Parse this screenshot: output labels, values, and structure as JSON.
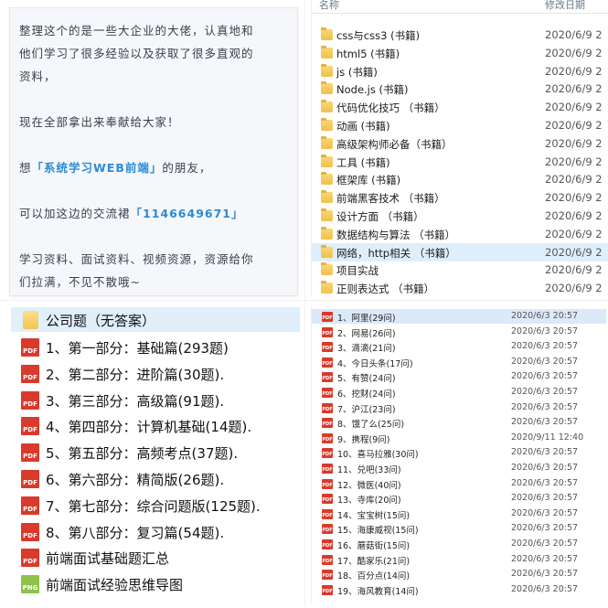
{
  "note": {
    "line1": "整理这个的是一些大企业的大佬，认真地和",
    "line2": "他们学习了很多经验以及获取了很多直观的",
    "line3": "资料，",
    "line4": "现在全部拿出来奉献给大家！",
    "line5_pre": "想",
    "line5_hl": "「系统学习WEB前端」",
    "line5_post": "的朋友，",
    "line6_pre": "可以加这边的交流裙",
    "line6_hl": "「1146649671」",
    "line7": "学习资料、面试资料、视频资源，资源给你",
    "line8": "们拉满，不见不散哦~"
  },
  "top_explorer": {
    "header_name": "名称",
    "header_date": "修改日期",
    "items": [
      {
        "name": "css与css3 (书籍)",
        "date": "2020/6/9 2"
      },
      {
        "name": "html5 (书籍)",
        "date": "2020/6/9 2"
      },
      {
        "name": "js (书籍)",
        "date": "2020/6/9 2"
      },
      {
        "name": "Node.js (书籍)",
        "date": "2020/6/9 2"
      },
      {
        "name": "代码优化技巧 （书籍）",
        "date": "2020/6/9 2"
      },
      {
        "name": "动画 (书籍)",
        "date": "2020/6/9 2"
      },
      {
        "name": "高级架构师必备（书籍）",
        "date": "2020/6/9 2"
      },
      {
        "name": "工具 (书籍)",
        "date": "2020/6/9 2"
      },
      {
        "name": "框架库 (书籍)",
        "date": "2020/6/9 2"
      },
      {
        "name": "前端黑客技术 （书籍）",
        "date": "2020/6/9 2"
      },
      {
        "name": "设计方面 （书籍）",
        "date": "2020/6/9 2"
      },
      {
        "name": "数据结构与算法 （书籍）",
        "date": "2020/6/9 2"
      },
      {
        "name": "网络，http相关 （书籍）",
        "date": "2020/6/9 2"
      },
      {
        "name": "项目实战",
        "date": "2020/6/9 2"
      },
      {
        "name": "正则表达式 （书籍）",
        "date": "2020/6/9 2"
      }
    ]
  },
  "bottom_left": {
    "folder": "公司题（无答案）",
    "items": [
      {
        "name": "1、第一部分：基础篇(293题)",
        "icon": "pdf"
      },
      {
        "name": "2、第二部分：进阶篇(30题).",
        "icon": "pdf"
      },
      {
        "name": "3、第三部分：高级篇(91题).",
        "icon": "pdf"
      },
      {
        "name": "4、第四部分：计算机基础(14题).",
        "icon": "pdf"
      },
      {
        "name": "5、第五部分：高频考点(37题).",
        "icon": "pdf"
      },
      {
        "name": "6、第六部分：精简版(26题).",
        "icon": "pdf"
      },
      {
        "name": "7、第七部分：综合问题版(125题).",
        "icon": "pdf"
      },
      {
        "name": "8、第八部分：复习篇(54题).",
        "icon": "pdf"
      },
      {
        "name": "前端面试基础题汇总",
        "icon": "pdf"
      },
      {
        "name": "前端面试经验思维导图",
        "icon": "png"
      }
    ]
  },
  "bottom_right": {
    "items": [
      {
        "name": "1、阿里(29问)",
        "date": "2020/6/3 20:57"
      },
      {
        "name": "2、网易(26问)",
        "date": "2020/6/3 20:57"
      },
      {
        "name": "3、滴滴(21问)",
        "date": "2020/6/3 20:57"
      },
      {
        "name": "4、今日头条(17问)",
        "date": "2020/6/3 20:57"
      },
      {
        "name": "5、有赞(24问)",
        "date": "2020/6/3 20:57"
      },
      {
        "name": "6、挖财(24问)",
        "date": "2020/6/3 20:57"
      },
      {
        "name": "7、沪江(23问)",
        "date": "2020/6/3 20:57"
      },
      {
        "name": "8、饿了么(25问)",
        "date": "2020/6/3 20:57"
      },
      {
        "name": "9、携程(9问)",
        "date": "2020/9/11 12:40"
      },
      {
        "name": "10、喜马拉雅(30问)",
        "date": "2020/6/3 20:57"
      },
      {
        "name": "11、兑吧(33问)",
        "date": "2020/6/3 20:57"
      },
      {
        "name": "12、微医(40问)",
        "date": "2020/6/3 20:57"
      },
      {
        "name": "13、寺库(20问)",
        "date": "2020/6/3 20:57"
      },
      {
        "name": "14、宝宝树(15问)",
        "date": "2020/6/3 20:57"
      },
      {
        "name": "15、海康威视(15问)",
        "date": "2020/6/3 20:57"
      },
      {
        "name": "16、蘑菇街(15问)",
        "date": "2020/6/3 20:57"
      },
      {
        "name": "17、酷家乐(21问)",
        "date": "2020/6/3 20:57"
      },
      {
        "name": "18、百分点(14问)",
        "date": "2020/6/3 20:57"
      },
      {
        "name": "19、海风教育(14问)",
        "date": "2020/6/3 20:57"
      }
    ]
  }
}
